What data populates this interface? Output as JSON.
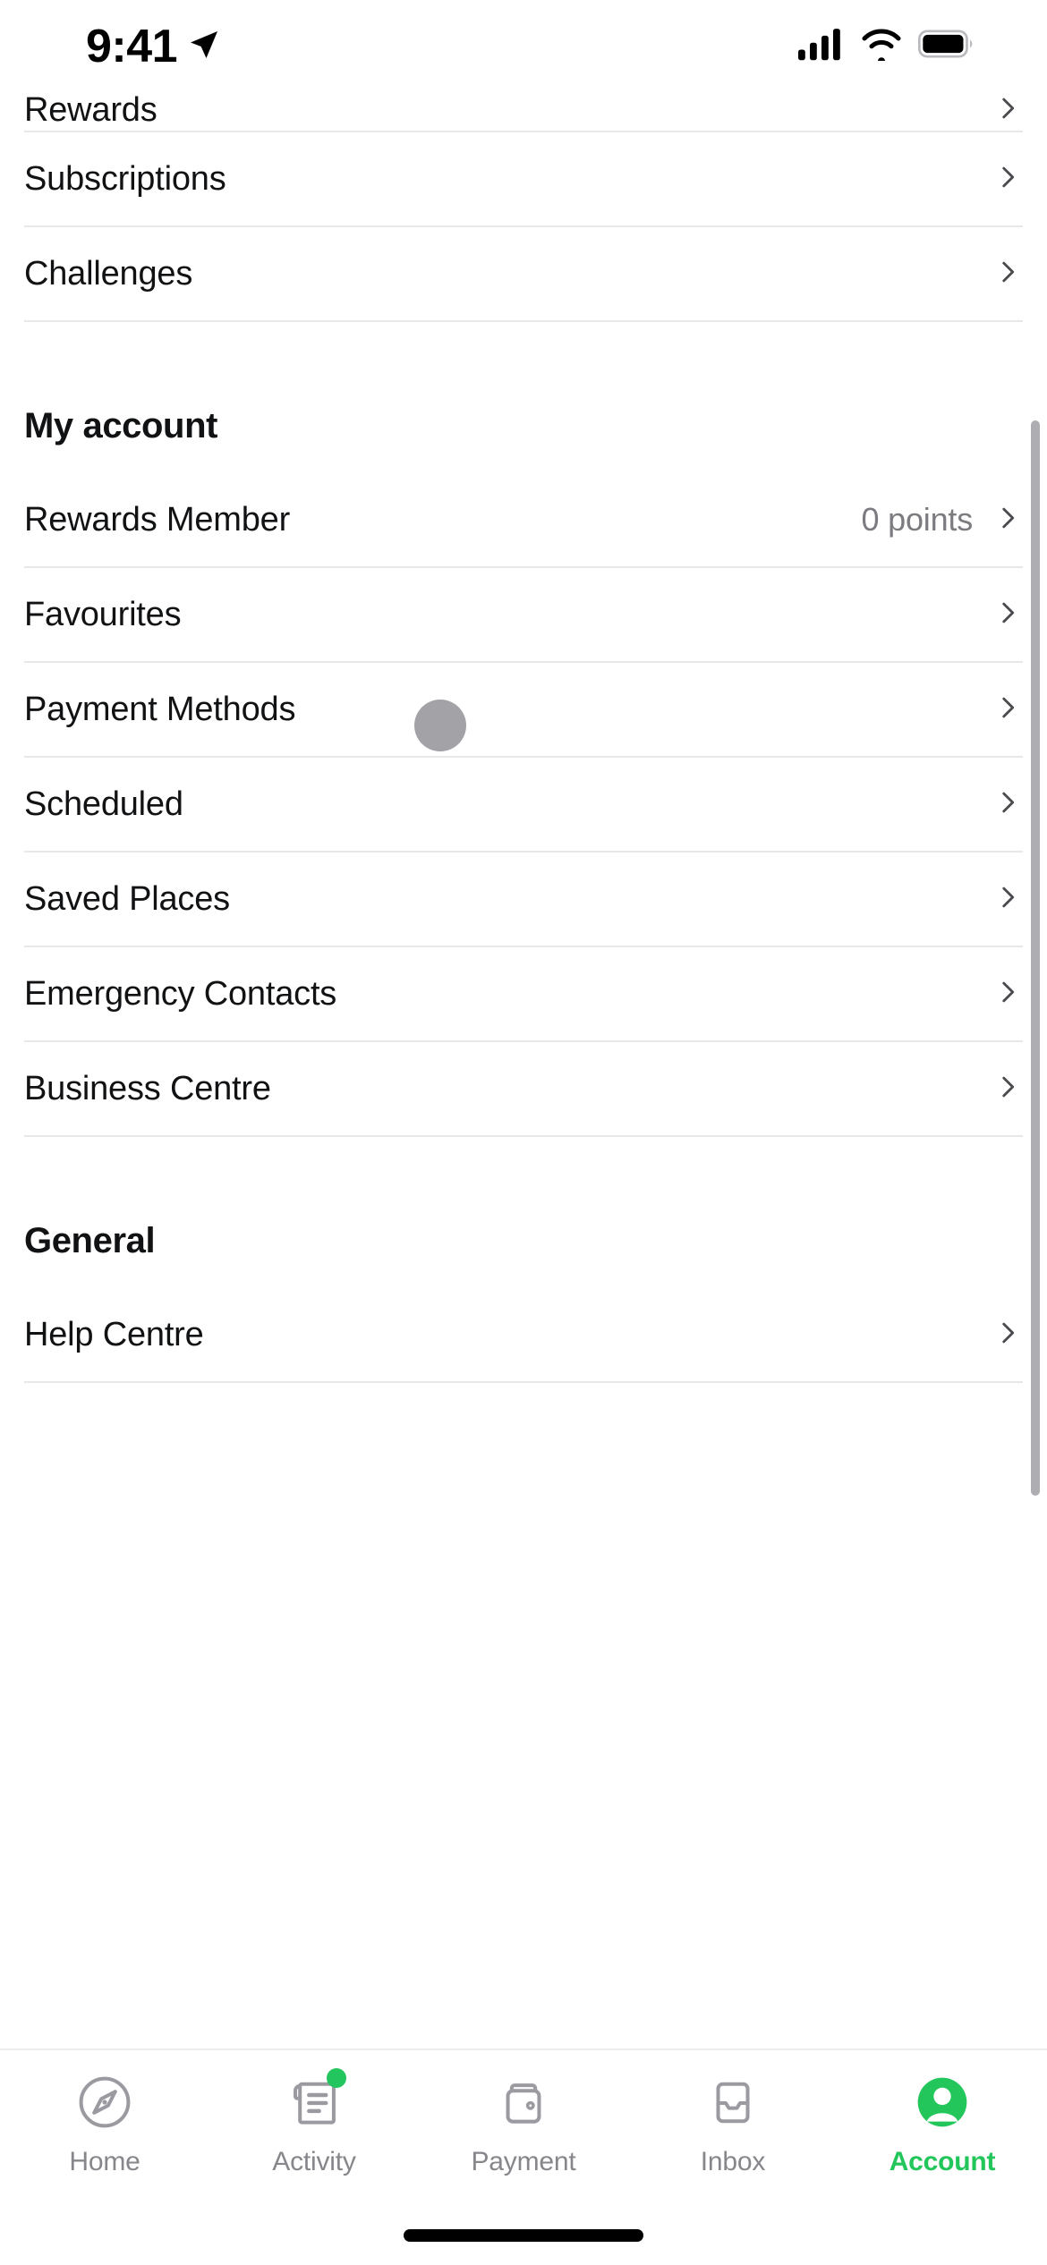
{
  "status_bar": {
    "time": "9:41",
    "location_icon": "location-arrow-icon",
    "signal_icon": "cellular-signal-icon",
    "wifi_icon": "wifi-icon",
    "battery_icon": "battery-full-icon"
  },
  "list": {
    "top_partial_row": {
      "label": "Rewards",
      "chevron": "chevron-right-icon"
    },
    "top_rows": [
      {
        "label": "Subscriptions",
        "chevron": "chevron-right-icon"
      },
      {
        "label": "Challenges",
        "chevron": "chevron-right-icon"
      }
    ]
  },
  "sections": [
    {
      "title": "My account",
      "rows": [
        {
          "label": "Rewards Member",
          "value": "0 points",
          "chevron": "chevron-right-icon"
        },
        {
          "label": "Favourites",
          "value": "",
          "chevron": "chevron-right-icon"
        },
        {
          "label": "Payment Methods",
          "value": "",
          "chevron": "chevron-right-icon"
        },
        {
          "label": "Scheduled",
          "value": "",
          "chevron": "chevron-right-icon"
        },
        {
          "label": "Saved Places",
          "value": "",
          "chevron": "chevron-right-icon"
        },
        {
          "label": "Emergency Contacts",
          "value": "",
          "chevron": "chevron-right-icon"
        },
        {
          "label": "Business Centre",
          "value": "",
          "chevron": "chevron-right-icon"
        }
      ]
    },
    {
      "title": "General",
      "rows": [
        {
          "label": "Help Centre",
          "value": "",
          "chevron": "chevron-right-icon"
        }
      ]
    }
  ],
  "skeleton": {
    "name": "avatar-placeholder-circle",
    "color": "#a2a2a7"
  },
  "scrollbar": {
    "name": "vertical-scrollbar"
  },
  "tabbar": {
    "items": [
      {
        "label": "Home",
        "icon": "compass-icon",
        "active": false,
        "badge": false
      },
      {
        "label": "Activity",
        "icon": "receipt-icon",
        "active": false,
        "badge": true
      },
      {
        "label": "Payment",
        "icon": "wallet-icon",
        "active": false,
        "badge": false
      },
      {
        "label": "Inbox",
        "icon": "inbox-icon",
        "active": false,
        "badge": false
      },
      {
        "label": "Account",
        "icon": "person-circle-icon",
        "active": true,
        "badge": false
      }
    ]
  },
  "colors": {
    "accent_green": "#23c65a",
    "badge_green": "#22c55e",
    "text_primary": "#111214",
    "text_secondary": "#7b7b80",
    "tab_inactive": "#86868b",
    "divider": "#e8e8ea"
  },
  "home_indicator": {
    "name": "home-indicator"
  }
}
